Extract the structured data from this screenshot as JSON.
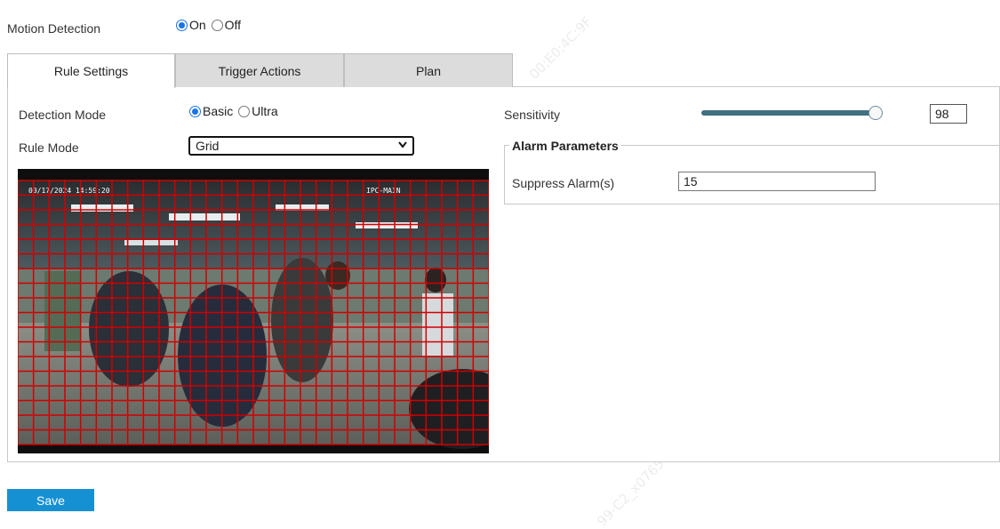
{
  "motion_detection": {
    "label": "Motion Detection",
    "options": [
      {
        "label": "On",
        "checked": true
      },
      {
        "label": "Off",
        "checked": false
      }
    ]
  },
  "tabs": [
    {
      "label": "Rule Settings",
      "active": true
    },
    {
      "label": "Trigger Actions",
      "active": false
    },
    {
      "label": "Plan",
      "active": false
    }
  ],
  "detection_mode": {
    "label": "Detection Mode",
    "options": [
      {
        "label": "Basic",
        "checked": true
      },
      {
        "label": "Ultra",
        "checked": false
      }
    ]
  },
  "rule_mode": {
    "label": "Rule Mode",
    "selected": "Grid"
  },
  "sensitivity": {
    "label": "Sensitivity",
    "value": "98",
    "level_percent": 98
  },
  "alarm_parameters": {
    "title": "Alarm Parameters",
    "suppress_label": "Suppress Alarm(s)",
    "suppress_value": "15"
  },
  "save_label": "Save",
  "colors": {
    "accent": "#1a73e8",
    "save_button": "#1591d3",
    "grid_line": "#d00000",
    "slider": "#41707f"
  }
}
